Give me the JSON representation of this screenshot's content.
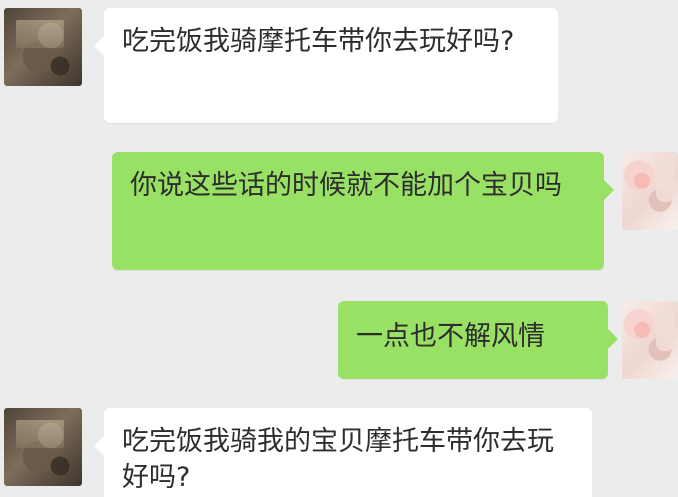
{
  "messages": [
    {
      "side": "left",
      "avatar": "user-avatar-left",
      "text": "吃完饭我骑摩托车带你去玩好吗?"
    },
    {
      "side": "right",
      "avatar": "user-avatar-right",
      "text": "你说这些话的时候就不能加个宝贝吗"
    },
    {
      "side": "right",
      "avatar": "user-avatar-right",
      "text": "一点也不解风情"
    },
    {
      "side": "left",
      "avatar": "user-avatar-left",
      "text": "吃完饭我骑我的宝贝摩托车带你去玩好吗?"
    }
  ],
  "colors": {
    "background": "#ececec",
    "incoming_bubble": "#ffffff",
    "outgoing_bubble": "#98e165",
    "text": "#2d2d2d"
  }
}
